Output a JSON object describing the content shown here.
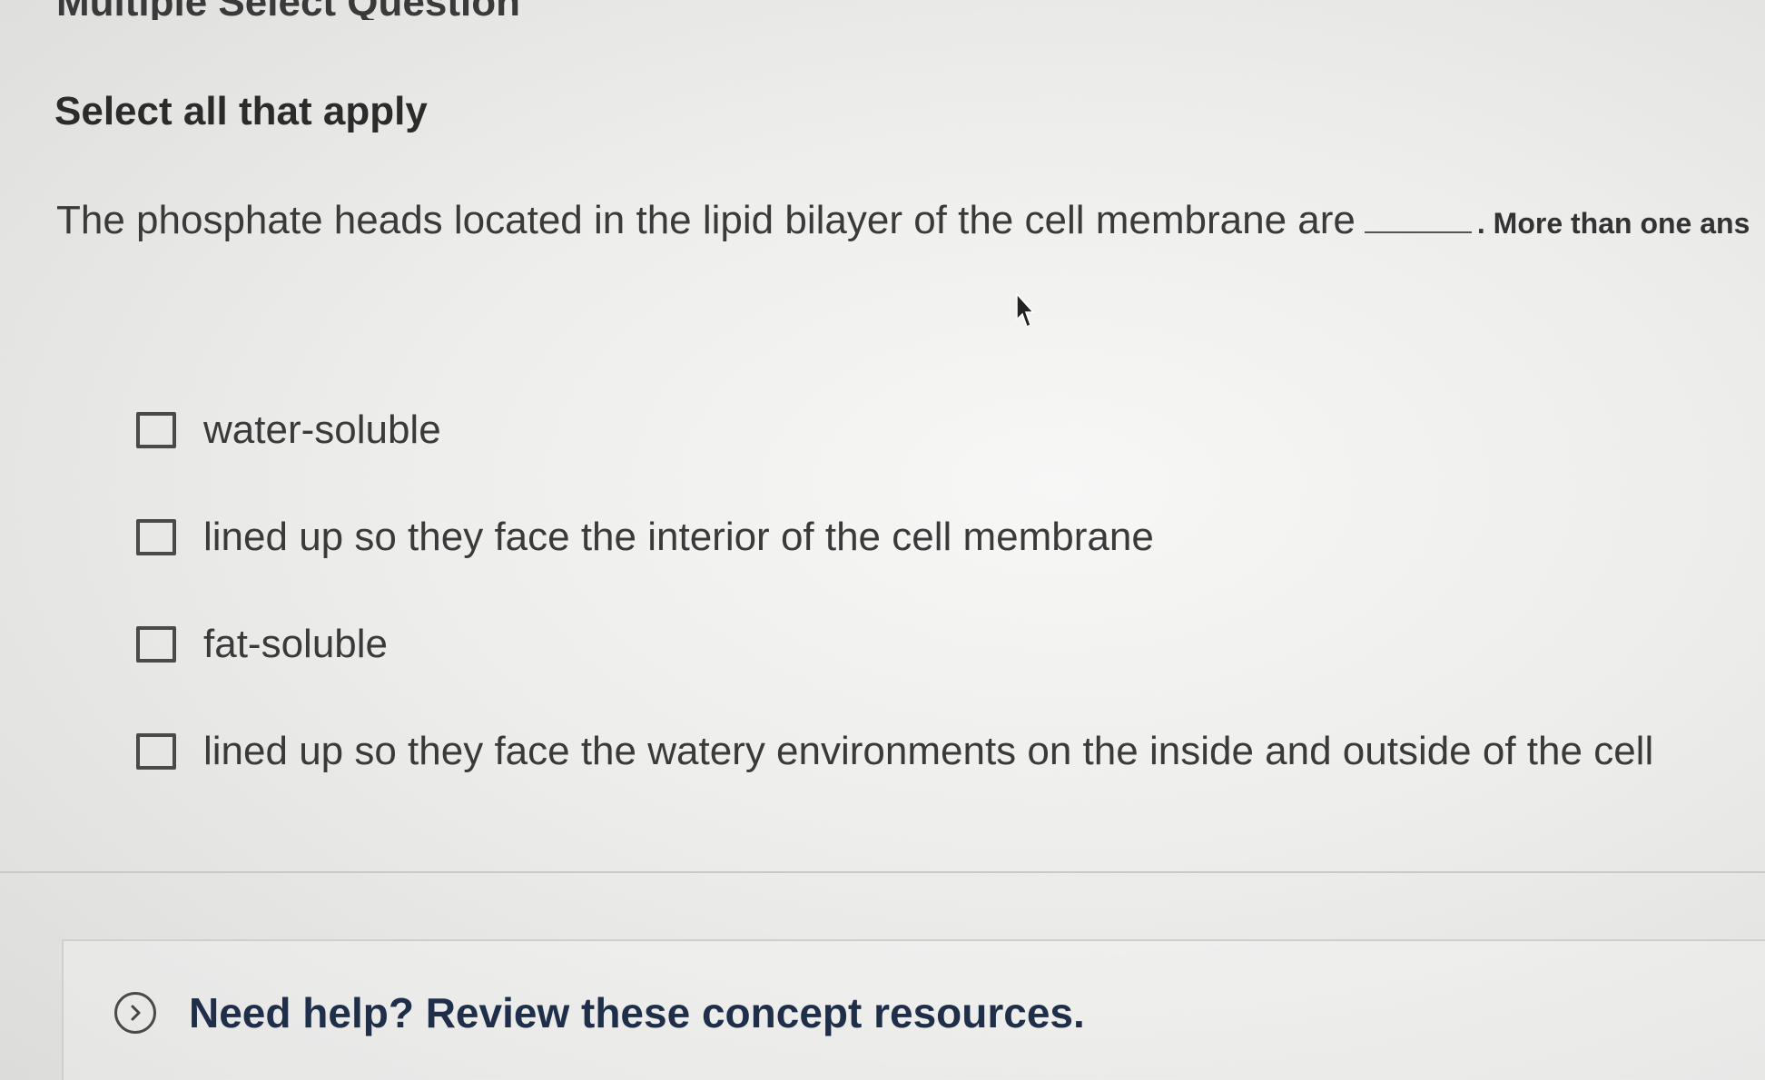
{
  "page": {
    "heading": "Multiple Select Question"
  },
  "question": {
    "instruction": "Select all that apply",
    "text": "The phosphate heads located in the lipid bilayer of the cell membrane are",
    "note": ". More than one ans"
  },
  "options": [
    {
      "label": "water-soluble",
      "checked": false
    },
    {
      "label": "lined up so they face the interior of the cell membrane",
      "checked": false
    },
    {
      "label": "fat-soluble",
      "checked": false
    },
    {
      "label": "lined up so they face the watery environments on the inside and outside of the cell",
      "checked": false
    }
  ],
  "help": {
    "label": "Need help? Review these concept resources.",
    "icon": "chevron-right-icon"
  }
}
